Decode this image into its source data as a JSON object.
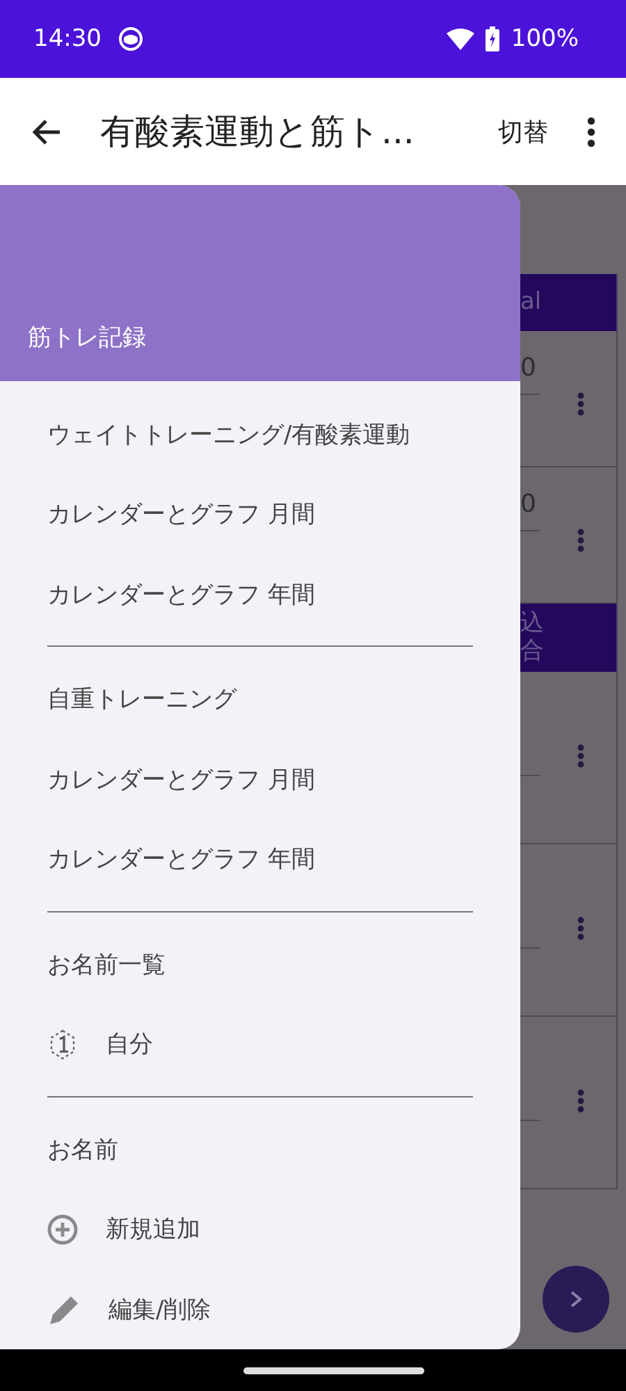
{
  "status_bar": {
    "time": "14:30",
    "battery": "100%"
  },
  "app_bar": {
    "title": "有酸素運動と筋ト...",
    "action": "切替"
  },
  "background": {
    "blocks": [
      {
        "kind": "header",
        "lines": [
          "al"
        ]
      },
      {
        "kind": "row",
        "value": "0"
      },
      {
        "kind": "row",
        "value": "0"
      },
      {
        "kind": "header",
        "lines": [
          "込",
          "合"
        ]
      },
      {
        "kind": "row"
      },
      {
        "kind": "row"
      },
      {
        "kind": "row"
      }
    ]
  },
  "drawer": {
    "header_title": "筋トレ記録",
    "sections": [
      {
        "items": [
          {
            "label": "ウェイトトレーニング/有酸素運動",
            "kind": "plain"
          },
          {
            "label": "カレンダーとグラフ 月間",
            "kind": "plain"
          },
          {
            "label": "カレンダーとグラフ 年間",
            "kind": "plain"
          }
        ]
      },
      {
        "items": [
          {
            "label": "自重トレーニング",
            "kind": "plain"
          },
          {
            "label": "カレンダーとグラフ 月間",
            "kind": "plain"
          },
          {
            "label": "カレンダーとグラフ 年間",
            "kind": "plain"
          }
        ]
      },
      {
        "items": [
          {
            "label": "お名前一覧",
            "kind": "plain"
          },
          {
            "label": "自分",
            "kind": "profile"
          }
        ]
      },
      {
        "items": [
          {
            "label": "お名前",
            "kind": "plain"
          },
          {
            "label": "新規追加",
            "kind": "add"
          },
          {
            "label": "編集/削除",
            "kind": "edit"
          }
        ]
      }
    ]
  }
}
